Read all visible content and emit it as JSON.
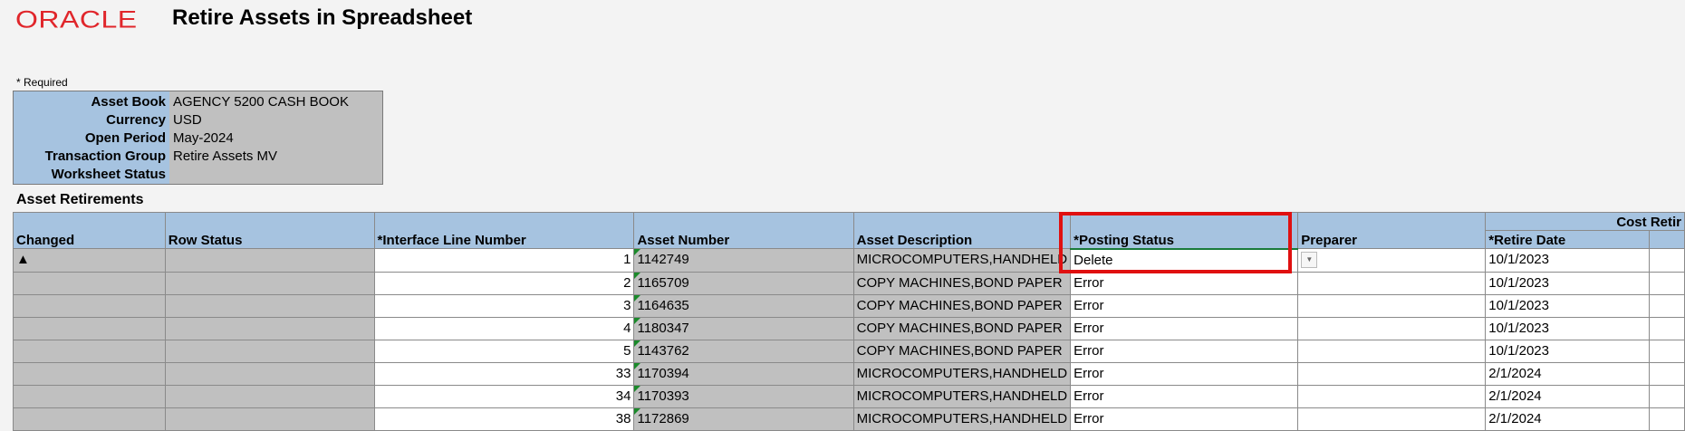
{
  "header": {
    "logo": "ORACLE",
    "title": "Retire Assets in Spreadsheet"
  },
  "required_note": "* Required",
  "info": [
    {
      "label": "Asset Book",
      "value": "AGENCY 5200 CASH BOOK"
    },
    {
      "label": "Currency",
      "value": "USD"
    },
    {
      "label": "Open Period",
      "value": "May-2024"
    },
    {
      "label": "Transaction Group",
      "value": "Retire Assets MV"
    },
    {
      "label": "Worksheet Status",
      "value": ""
    }
  ],
  "section_title": "Asset Retirements",
  "table": {
    "group_header": "Cost Retir",
    "columns": [
      "Changed",
      "Row Status",
      "*Interface Line Number",
      "Asset Number",
      "Asset Description",
      "*Posting Status",
      "Preparer",
      "*Retire Date"
    ],
    "rows": [
      {
        "changed": "▲",
        "row_status": "",
        "line": "1",
        "asset": "1142749",
        "desc": "MICROCOMPUTERS,HANDHELD",
        "posting": "Delete",
        "preparer": "",
        "date": "10/1/2023"
      },
      {
        "changed": "",
        "row_status": "",
        "line": "2",
        "asset": "1165709",
        "desc": "COPY MACHINES,BOND PAPER",
        "posting": "Error",
        "preparer": "",
        "date": "10/1/2023"
      },
      {
        "changed": "",
        "row_status": "",
        "line": "3",
        "asset": "1164635",
        "desc": "COPY MACHINES,BOND PAPER",
        "posting": "Error",
        "preparer": "",
        "date": "10/1/2023"
      },
      {
        "changed": "",
        "row_status": "",
        "line": "4",
        "asset": "1180347",
        "desc": "COPY MACHINES,BOND PAPER",
        "posting": "Error",
        "preparer": "",
        "date": "10/1/2023"
      },
      {
        "changed": "",
        "row_status": "",
        "line": "5",
        "asset": "1143762",
        "desc": "COPY MACHINES,BOND PAPER",
        "posting": "Error",
        "preparer": "",
        "date": "10/1/2023"
      },
      {
        "changed": "",
        "row_status": "",
        "line": "33",
        "asset": "1170394",
        "desc": "MICROCOMPUTERS,HANDHELD",
        "posting": "Error",
        "preparer": "",
        "date": "2/1/2024"
      },
      {
        "changed": "",
        "row_status": "",
        "line": "34",
        "asset": "1170393",
        "desc": "MICROCOMPUTERS,HANDHELD",
        "posting": "Error",
        "preparer": "",
        "date": "2/1/2024"
      },
      {
        "changed": "",
        "row_status": "",
        "line": "38",
        "asset": "1172869",
        "desc": "MICROCOMPUTERS,HANDHELD",
        "posting": "Error",
        "preparer": "",
        "date": "2/1/2024"
      }
    ]
  },
  "colors": {
    "header_blue": "#a6c3e0",
    "readonly_gray": "#c0c0c0",
    "highlight_red": "#e01010",
    "oracle_red": "#e0262b"
  }
}
